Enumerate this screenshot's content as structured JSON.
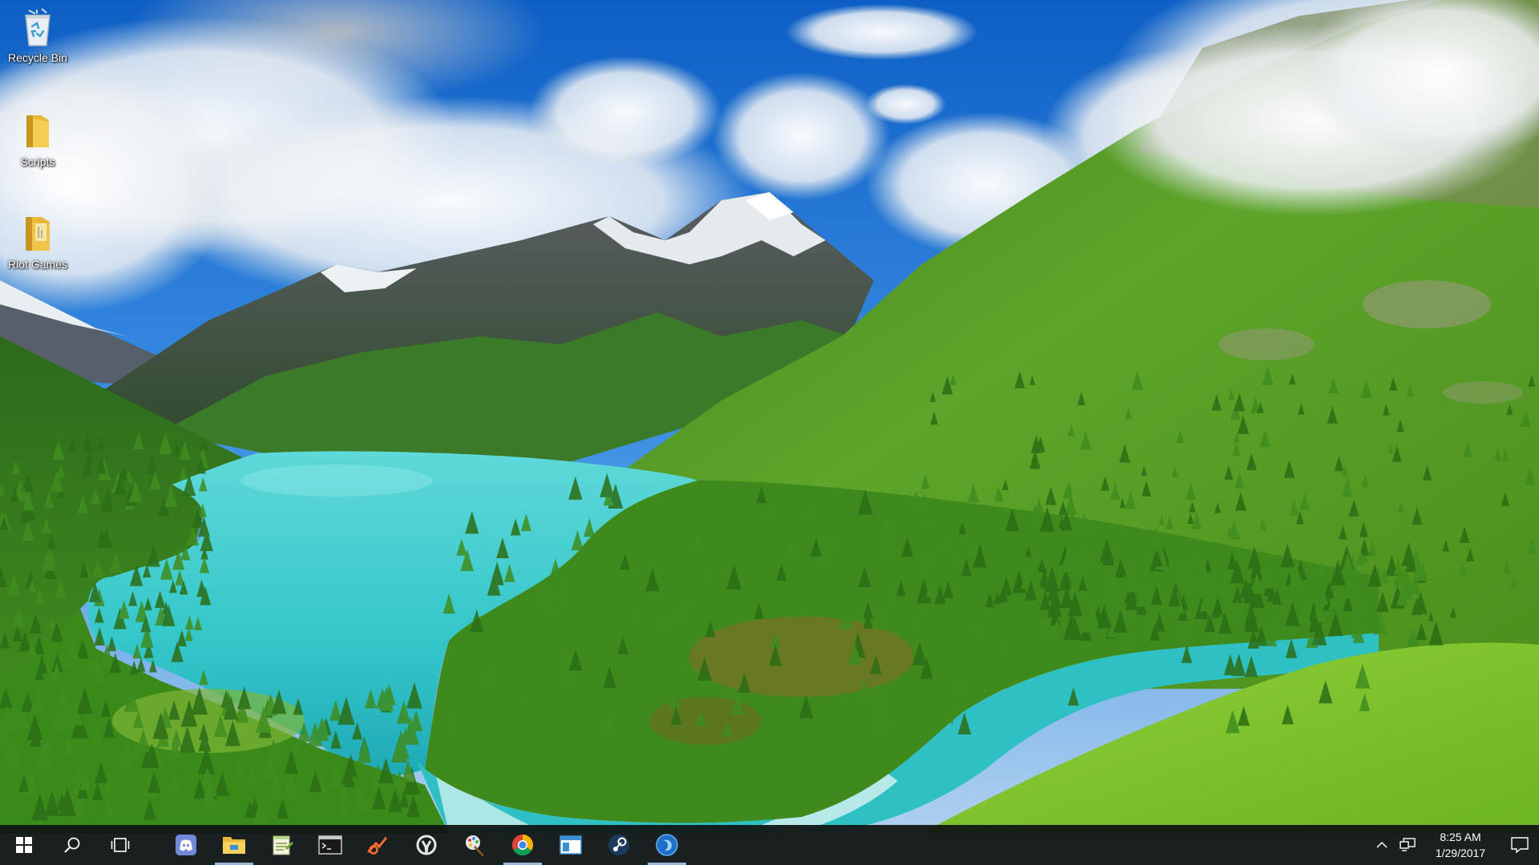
{
  "desktop": {
    "icons": [
      {
        "label": "Recycle Bin",
        "icon": "recycle-bin-icon"
      },
      {
        "label": "Scripts",
        "icon": "folder-icon"
      },
      {
        "label": "Riot Games",
        "icon": "folder-icon"
      }
    ]
  },
  "taskbar": {
    "left_buttons": [
      {
        "name": "start",
        "icon": "windows-logo-icon"
      },
      {
        "name": "search",
        "icon": "search-icon"
      },
      {
        "name": "task-view",
        "icon": "task-view-icon"
      }
    ],
    "apps": [
      {
        "name": "discord",
        "icon": "discord-icon",
        "running": false
      },
      {
        "name": "file-explorer",
        "icon": "folder-icon",
        "running": true
      },
      {
        "name": "notepad-plus",
        "icon": "notepad-icon",
        "running": false
      },
      {
        "name": "command-prompt",
        "icon": "terminal-icon",
        "running": false
      },
      {
        "name": "origin",
        "icon": "origin-icon",
        "running": false
      },
      {
        "name": "overwatch",
        "icon": "overwatch-icon",
        "running": false
      },
      {
        "name": "paint",
        "icon": "paint-icon",
        "running": false
      },
      {
        "name": "chrome",
        "icon": "chrome-icon",
        "running": true
      },
      {
        "name": "window-app",
        "icon": "window-icon",
        "running": false
      },
      {
        "name": "steam",
        "icon": "steam-icon",
        "running": false
      },
      {
        "name": "blue-app",
        "icon": "globe-icon",
        "running": true
      }
    ],
    "tray": {
      "time": "8:25 AM",
      "date": "1/29/2017"
    }
  },
  "colors": {
    "taskbar": "#101412",
    "running_indicator": "#9ab8d8",
    "sky": "#1f7ad8",
    "lake": "#3fd0cf",
    "forest": "#4f9a1e"
  }
}
